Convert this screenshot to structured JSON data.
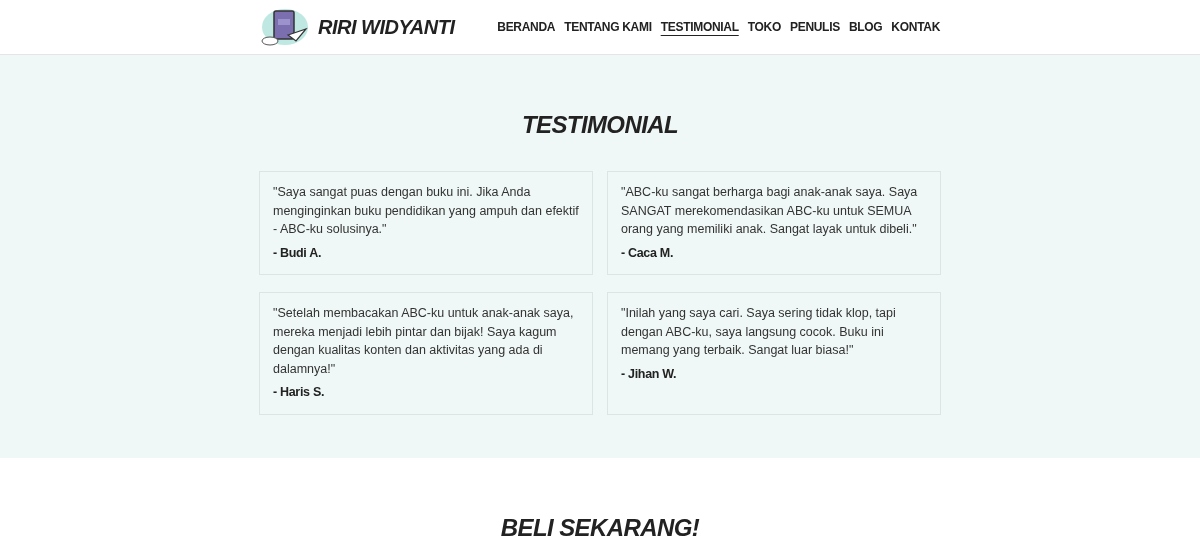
{
  "header": {
    "brand": "RIRI WIDYANTI",
    "nav": [
      {
        "label": "BERANDA",
        "selected": false
      },
      {
        "label": "TENTANG KAMI",
        "selected": false
      },
      {
        "label": "TESTIMONIAL",
        "selected": true
      },
      {
        "label": "TOKO",
        "selected": false
      },
      {
        "label": "PENULIS",
        "selected": false
      },
      {
        "label": "BLOG",
        "selected": false
      },
      {
        "label": "KONTAK",
        "selected": false
      }
    ]
  },
  "testimonials": {
    "title": "TESTIMONIAL",
    "items": [
      {
        "quote": "\"Saya sangat puas dengan buku ini. Jika Anda menginginkan buku pendidikan yang ampuh dan efektif - ABC-ku solusinya.\"",
        "author": "- Budi A."
      },
      {
        "quote": "\"ABC-ku sangat berharga bagi anak-anak saya. Saya SANGAT merekomendasikan ABC-ku untuk SEMUA orang yang memiliki anak. Sangat layak untuk dibeli.\"",
        "author": "- Caca M."
      },
      {
        "quote": "\"Setelah membacakan ABC-ku untuk anak-anak saya, mereka menjadi lebih pintar dan bijak! Saya kagum dengan kualitas konten dan aktivitas yang ada di dalamnya!\"",
        "author": "- Haris S."
      },
      {
        "quote": "\"Inilah yang saya cari. Saya sering tidak klop, tapi dengan ABC-ku, saya langsung cocok. Buku ini memang yang terbaik. Sangat luar biasa!\"",
        "author": "- Jihan W."
      }
    ]
  },
  "buy": {
    "title": "BELI SEKARANG!"
  }
}
